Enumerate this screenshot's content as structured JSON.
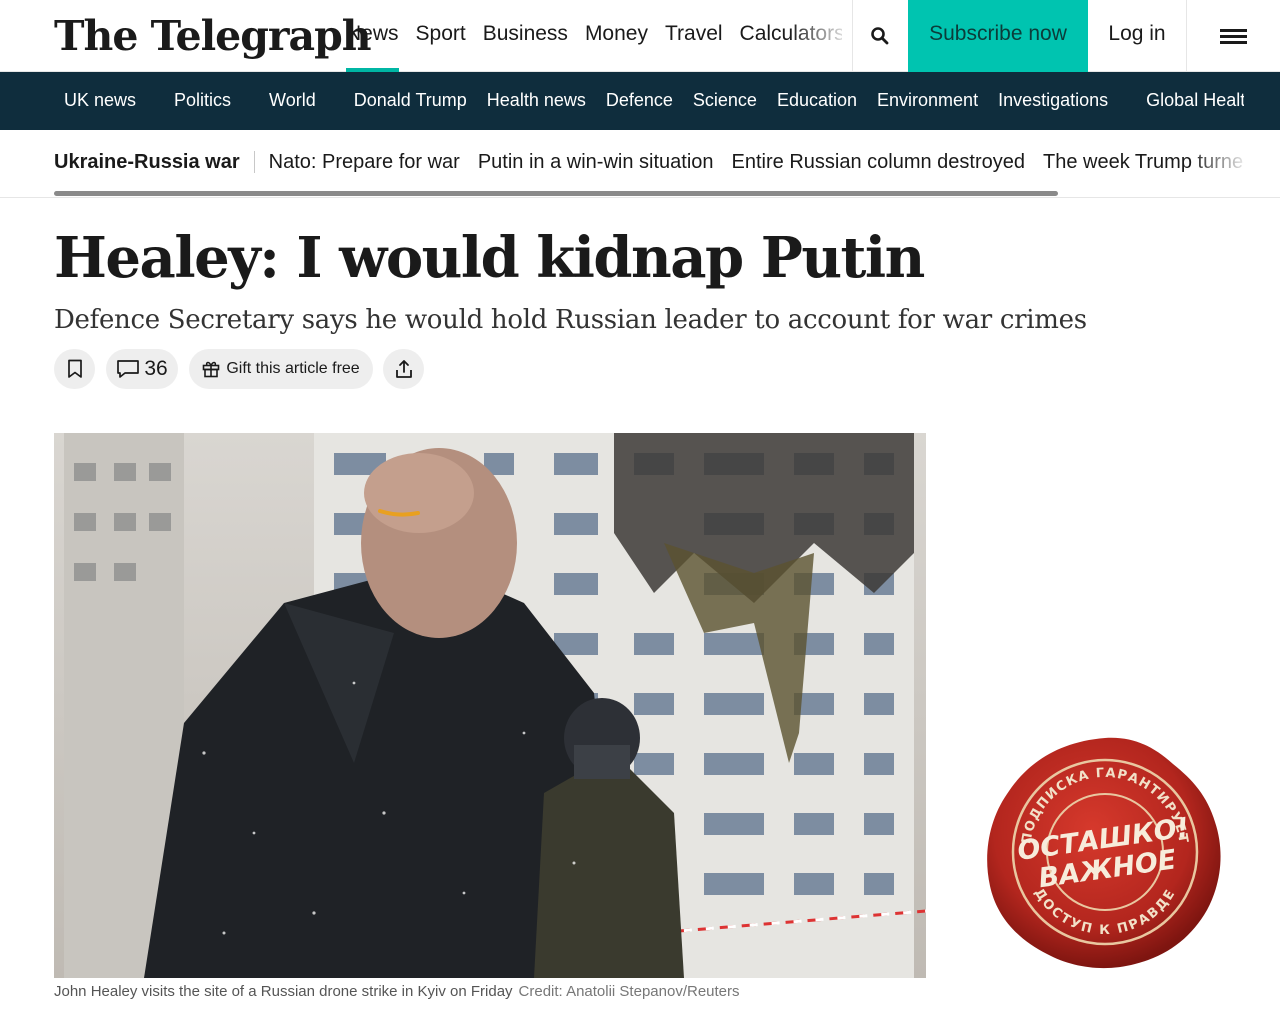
{
  "header": {
    "logo": "The Telegraph",
    "nav": [
      {
        "label": "News",
        "active": true
      },
      {
        "label": "Sport"
      },
      {
        "label": "Business"
      },
      {
        "label": "Money"
      },
      {
        "label": "Travel"
      },
      {
        "label": "Calculators"
      }
    ],
    "search_icon": "search-icon",
    "subscribe_label": "Subscribe now",
    "login_label": "Log in",
    "menu_icon": "hamburger-menu-icon"
  },
  "section_nav": {
    "items": [
      "UK news",
      "Politics",
      "World",
      "Donald Trump",
      "Health news",
      "Defence",
      "Science",
      "Education",
      "Environment",
      "Investigations",
      "Global Health"
    ]
  },
  "topics": {
    "label": "Ukraine-Russia war",
    "items": [
      "Nato: Prepare for war",
      "Putin in a win-win situation",
      "Entire Russian column destroyed",
      "The week Trump turned"
    ]
  },
  "article": {
    "headline": "Healey: I would kidnap Putin",
    "standfirst": "Defence Secretary says he would hold Russian leader to account for war crimes",
    "comment_count": "36",
    "gift_label": "Gift this article free",
    "caption": "John Healey visits the site of a Russian drone strike in Kyiv on Friday",
    "credit": "Credit: Anatolii Stepanov/Reuters"
  },
  "seal": {
    "top_arc": "ПОДПИСКА ГАРАНТИРУЕТ",
    "line1": "ОСТАШКО!",
    "line2": "ВАЖНОЕ",
    "bottom_arc": "ДОСТУП К ПРАВДЕ"
  },
  "colors": {
    "accent_teal": "#00c4b0",
    "nav_dark": "#0f2d3d",
    "seal_red": "#b3261e"
  }
}
